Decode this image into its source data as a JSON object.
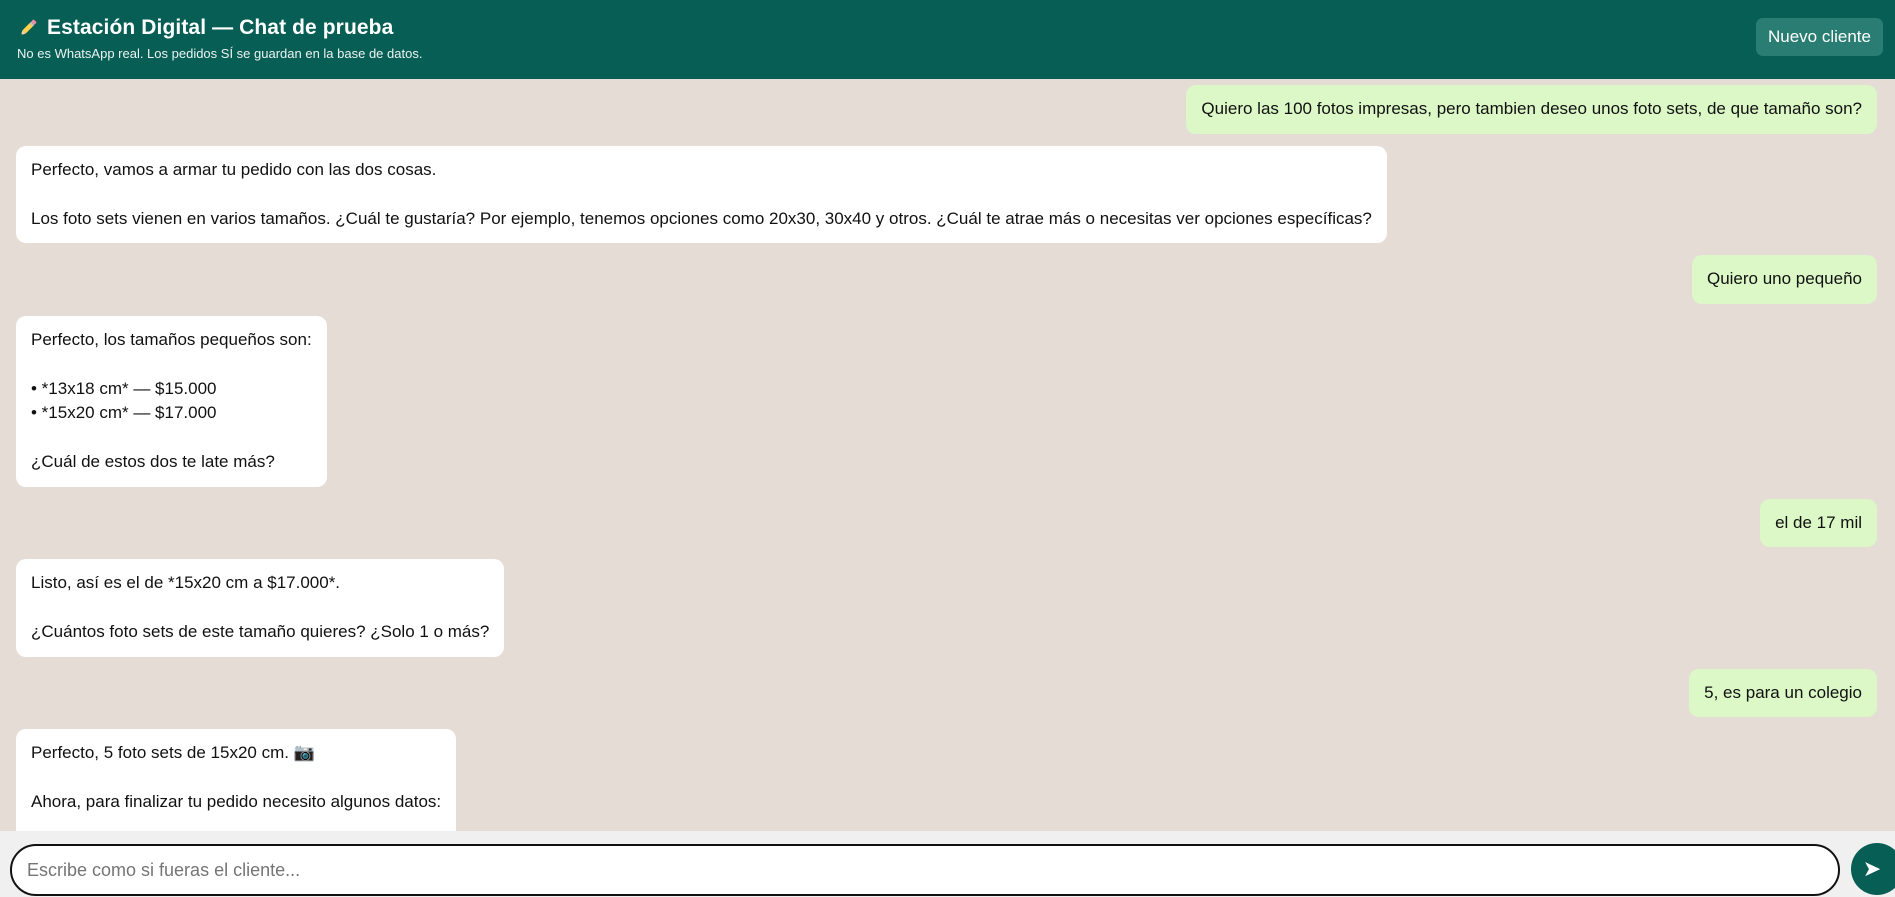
{
  "header": {
    "title": "Estación Digital — Chat de prueba",
    "subtitle": "No es WhatsApp real. Los pedidos SÍ se guardan en la base de datos.",
    "new_client_label": "Nuevo cliente",
    "icon": "pencil-icon"
  },
  "messages": [
    {
      "sender": "user",
      "text": "Quiero las 100 fotos impresas, pero tambien deseo unos foto sets, de que tamaño son?"
    },
    {
      "sender": "bot",
      "text": "Perfecto, vamos a armar tu pedido con las dos cosas.\n\nLos foto sets vienen en varios tamaños. ¿Cuál te gustaría? Por ejemplo, tenemos opciones como 20x30, 30x40 y otros. ¿Cuál te atrae más o necesitas ver opciones específicas?"
    },
    {
      "sender": "user",
      "text": "Quiero uno pequeño"
    },
    {
      "sender": "bot",
      "text": "Perfecto, los tamaños pequeños son:\n\n• *13x18 cm* — $15.000\n• *15x20 cm* — $17.000\n\n¿Cuál de estos dos te late más?"
    },
    {
      "sender": "user",
      "text": "el de 17 mil"
    },
    {
      "sender": "bot",
      "text": "Listo, así es el de *15x20 cm a $17.000*.\n\n¿Cuántos foto sets de este tamaño quieres? ¿Solo 1 o más?"
    },
    {
      "sender": "user",
      "text": "5, es para un colegio"
    },
    {
      "sender": "bot",
      "text": "Perfecto, 5 foto sets de 15x20 cm. 📷\n\nAhora, para finalizar tu pedido necesito algunos datos:\n\n¿Cuál es tu *nombre completo*?"
    }
  ],
  "input": {
    "placeholder": "Escribe como si fueras el cliente...",
    "value": ""
  },
  "send": {
    "icon": "send-icon",
    "glyph": "➤"
  },
  "colors": {
    "header_bg": "#075e54",
    "chat_bg": "#e5ddd5",
    "user_bubble": "#dcf8c6",
    "bot_bubble": "#ffffff",
    "button_bg": "#2a7d72"
  }
}
